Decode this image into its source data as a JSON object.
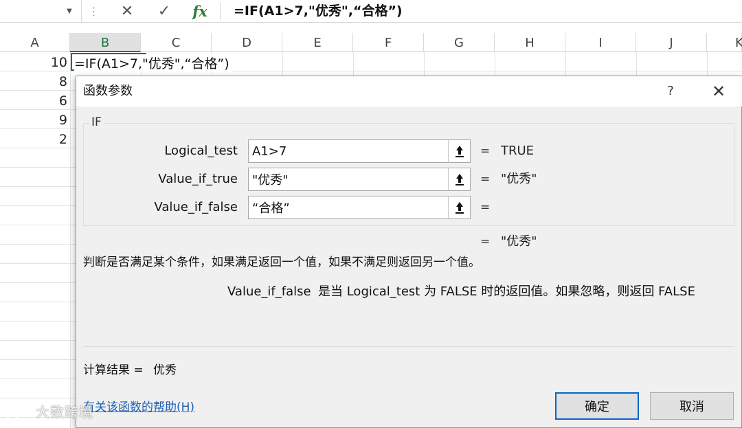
{
  "formula_bar": {
    "formula": "=IF(A1>7,\"优秀\",“合格”)",
    "cancel_glyph": "✕",
    "enter_glyph": "✓",
    "fx_label": "fx"
  },
  "columns": [
    "A",
    "B",
    "C",
    "D",
    "E",
    "F",
    "G",
    "H",
    "I",
    "J",
    "K"
  ],
  "active_column": "B",
  "cells": {
    "a_values": [
      "10",
      "8",
      "6",
      "9",
      "2"
    ],
    "b1": "=IF(A1>7,\"优秀\",“合格”)"
  },
  "dialog": {
    "title": "函数参数",
    "help_glyph": "?",
    "close_glyph": "✕",
    "group_label": "IF",
    "args": [
      {
        "label": "Logical_test",
        "value": "A1>7",
        "result": "TRUE"
      },
      {
        "label": "Value_if_true",
        "value": "\"优秀\"",
        "result": "\"优秀\""
      },
      {
        "label": "Value_if_false",
        "value": "“合格”",
        "result": ""
      }
    ],
    "arg_eq": "=",
    "formula_result": "\"优秀\"",
    "description": "判断是否满足某个条件，如果满足返回一个值，如果不满足则返回另一个值。",
    "current_arg_name": "Value_if_false",
    "current_arg_desc": "是当 Logical_test 为 FALSE 时的返回值。如果忽略，则返回 FALSE",
    "calc_label": "计算结果 =",
    "calc_value": "优秀",
    "help_link": "有关该函数的帮助(H)",
    "ok_label": "确定",
    "cancel_label": "取消"
  },
  "watermark": "大数跨境",
  "colors": {
    "accent_green": "#217346",
    "link_blue": "#1a5fb4",
    "ok_border": "#0a64c8"
  }
}
